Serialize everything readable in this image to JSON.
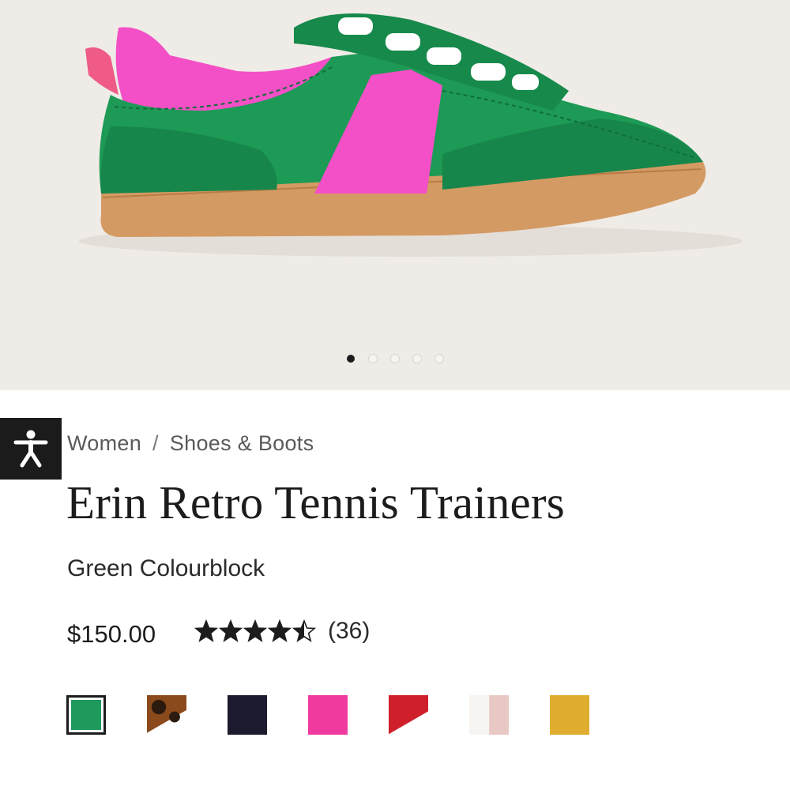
{
  "gallery": {
    "image_alt": "Green and pink retro tennis trainer with gum sole",
    "slide_count": 5,
    "active_slide": 1
  },
  "accessibility": {
    "icon": "accessibility-person-icon"
  },
  "breadcrumb": {
    "items": [
      "Women",
      "Shoes & Boots"
    ],
    "separator": "/"
  },
  "product": {
    "title": "Erin Retro Tennis Trainers",
    "colour": "Green Colourblock",
    "price": "$150.00",
    "rating": 4.5,
    "rating_max": 5,
    "review_count": "(36)"
  },
  "swatches": [
    {
      "name": "green",
      "color": "#1f9a5c",
      "selected": true
    },
    {
      "name": "leopard",
      "color": "#8a4a1c",
      "selected": false
    },
    {
      "name": "navy",
      "color": "#1d1b2e",
      "selected": false
    },
    {
      "name": "pink",
      "color": "#f03a9e",
      "selected": false
    },
    {
      "name": "red",
      "color": "#cf1f2b",
      "selected": false
    },
    {
      "name": "white-pink",
      "color": "#f2ece6",
      "selected": false
    },
    {
      "name": "mustard",
      "color": "#e0ad2f",
      "selected": false
    }
  ],
  "colors": {
    "hero_bg": "#efebe6",
    "shoe_green": "#1d9a55",
    "shoe_pink": "#f34fc6",
    "sole": "#d49a63"
  }
}
